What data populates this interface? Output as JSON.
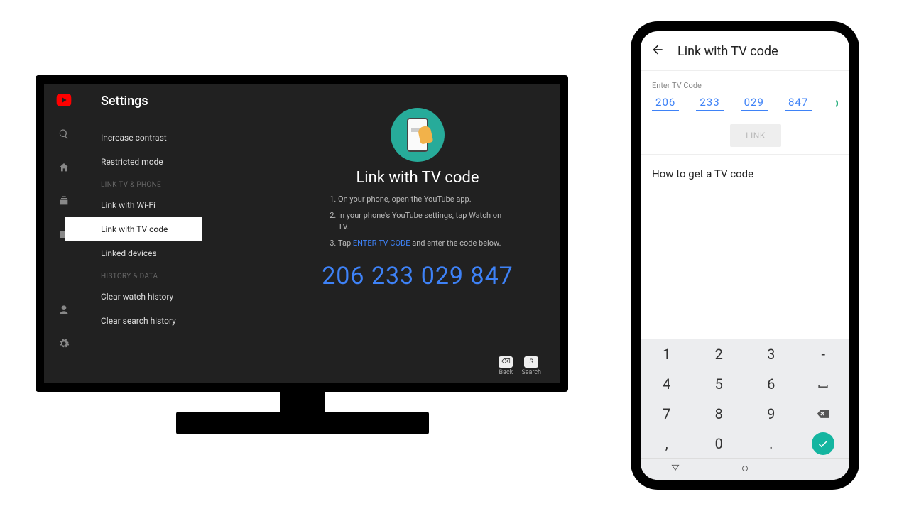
{
  "tv": {
    "title": "Settings",
    "menu": {
      "items_top": [
        {
          "label": "Increase contrast"
        },
        {
          "label": "Restricted mode"
        }
      ],
      "section1": "LINK TV & PHONE",
      "items_link": [
        {
          "label": "Link with Wi-Fi"
        },
        {
          "label": "Link with TV code",
          "active": true
        },
        {
          "label": "Linked devices"
        }
      ],
      "section2": "HISTORY & DATA",
      "items_history": [
        {
          "label": "Clear watch history"
        },
        {
          "label": "Clear search history"
        }
      ]
    },
    "detail": {
      "heading": "Link with TV code",
      "steps": [
        "On your phone, open the YouTube app.",
        "In your phone's YouTube settings, tap Watch on TV.",
        {
          "pre": "Tap ",
          "blue": "ENTER TV CODE",
          "post": " and enter the code below."
        }
      ],
      "code": "206 233 029 847"
    },
    "hints": {
      "back": "Back",
      "search": "Search",
      "search_key": "S"
    }
  },
  "phone": {
    "appbar_title": "Link with TV code",
    "form": {
      "label": "Enter TV Code",
      "groups": [
        "206",
        "233",
        "029",
        "847"
      ],
      "button": "LINK"
    },
    "howto": "How to get a TV code",
    "keypad": [
      [
        "1",
        "2",
        "3",
        "-"
      ],
      [
        "4",
        "5",
        "6",
        "space"
      ],
      [
        "7",
        "8",
        "9",
        "backspace"
      ],
      [
        ",",
        "0",
        ".",
        "enter"
      ]
    ]
  }
}
